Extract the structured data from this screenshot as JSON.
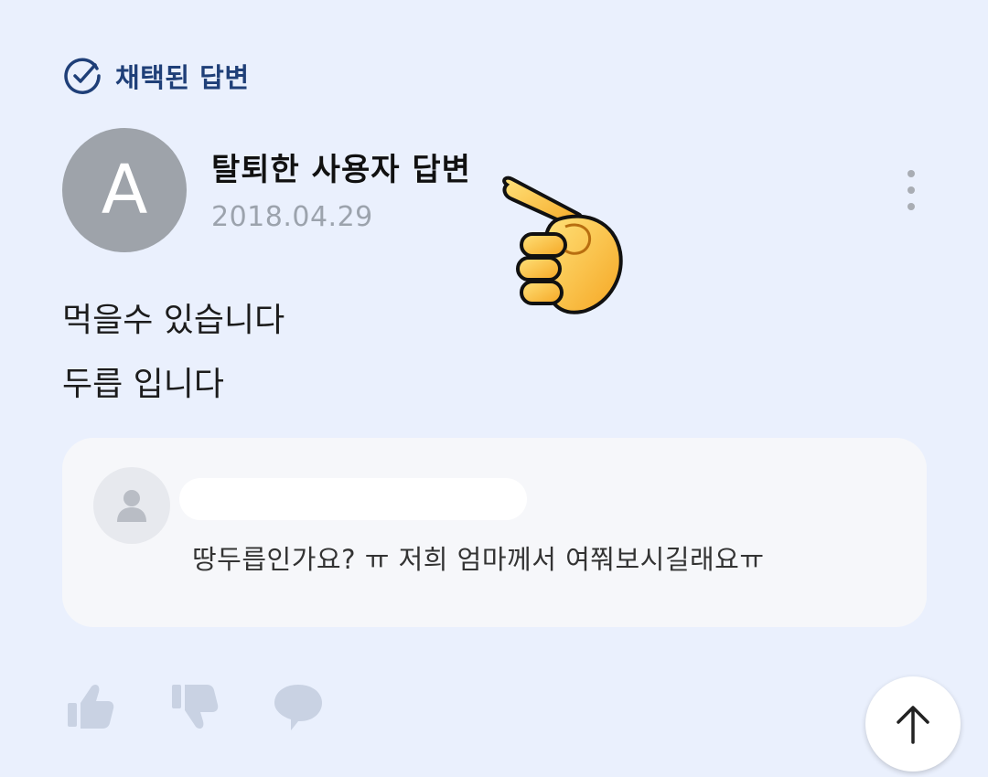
{
  "badge": {
    "label": "채택된 답변",
    "icon": "check-circle-icon",
    "color": "#1f3f78"
  },
  "answer": {
    "avatar_letter": "A",
    "author": "탈퇴한 사용자 답변",
    "date": "2018.04.29",
    "lines": [
      "먹을수 있습니다",
      "두릅 입니다"
    ]
  },
  "comment": {
    "avatar_icon": "user-silhouette-icon",
    "text": "땅두릅인가요? ㅠ 저희 엄마께서 여쭤보시길래요ㅠ"
  },
  "actions": {
    "like_icon": "thumbs-up-icon",
    "dislike_icon": "thumbs-down-icon",
    "comment_icon": "speech-bubble-icon",
    "more_icon": "more-vertical-icon",
    "scroll_top_icon": "arrow-up-icon"
  },
  "colors": {
    "background": "#eaf0fd",
    "avatar": "#9ea3aa",
    "comment_bg": "#f6f7fa",
    "muted_icon": "#c9d2e3"
  }
}
